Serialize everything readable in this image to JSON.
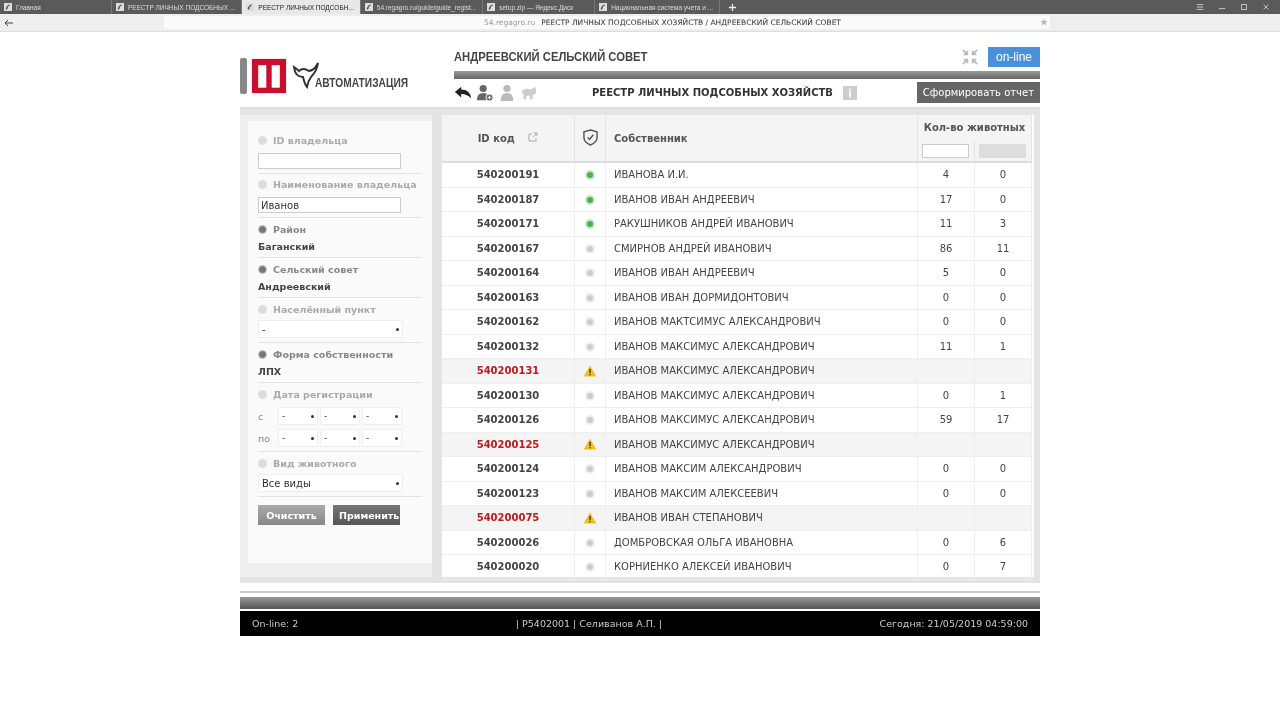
{
  "browser": {
    "tabs": [
      {
        "label": "Главная",
        "selected": false
      },
      {
        "label": "РЕЕСТР ЛИЧНЫХ ПОДСОБНЫХ ...",
        "selected": false
      },
      {
        "label": "РЕЕСТР ЛИЧНЫХ ПОДСОБН...",
        "selected": true
      },
      {
        "label": "54.regagro.ru/guide/guide_regist...",
        "selected": false
      },
      {
        "label": "setup.zip — Яндекс.Диск",
        "selected": false
      },
      {
        "label": "Национальная система учета и ...",
        "selected": false
      }
    ],
    "address": {
      "host": "54.regagro.ru",
      "title": "РЕЕСТР ЛИЧНЫХ ПОДСОБНЫХ ХОЗЯЙСТВ / АНДРЕЕВСКИЙ СЕЛЬСКИЙ СОВЕТ"
    }
  },
  "header": {
    "logo_text": "АВТОМАТИЗАЦИЯ",
    "council": "АНДРЕЕВСКИЙ СЕЛЬСКИЙ СОВЕТ",
    "status": "on-line",
    "page_title": "РЕЕСТР ЛИЧНЫХ ПОДСОБНЫХ ХОЗЯЙСТВ",
    "report_button": "Сформировать отчет"
  },
  "filters": [
    {
      "kind": "text",
      "label": "ID владельца",
      "checked": false
    },
    {
      "kind": "text",
      "label": "Наименование владельца",
      "checked": false,
      "value": "Иванов"
    },
    {
      "kind": "static",
      "label": "Район",
      "checked": true,
      "value": "Баганский"
    },
    {
      "kind": "static",
      "label": "Сельский совет",
      "checked": true,
      "value": "Андреевский"
    },
    {
      "kind": "select",
      "label": "Населённый пункт",
      "checked": false,
      "value": "-"
    },
    {
      "kind": "static",
      "label": "Форма собственности",
      "checked": true,
      "value": "ЛПХ"
    },
    {
      "kind": "dates",
      "label": "Дата регистрации",
      "checked": false,
      "rows": [
        {
          "label": "с",
          "values": [
            "-",
            "-",
            "-"
          ]
        },
        {
          "label": "по",
          "values": [
            "-",
            "-",
            "-"
          ]
        }
      ]
    },
    {
      "kind": "select",
      "label": "Вид животного",
      "checked": false,
      "value": "Все виды"
    }
  ],
  "filter_buttons": [
    "Очистить",
    "Применить"
  ],
  "table": {
    "columns": {
      "id": "ID код",
      "owner": "Собственник",
      "animals": "Кол-во животных"
    },
    "rows": [
      {
        "id": "540200191",
        "kind": "active",
        "owner": "ИВАНОВА И.И.",
        "col_1": "4",
        "col_2": "0"
      },
      {
        "id": "540200187",
        "kind": "active",
        "owner": "ИВАНОВ ИВАН АНДРЕЕВИЧ",
        "col_1": "17",
        "col_2": "0"
      },
      {
        "id": "540200171",
        "kind": "active",
        "owner": "РАКУШНИКОВ АНДРЕЙ ИВАНОВИЧ",
        "col_1": "11",
        "col_2": "3"
      },
      {
        "id": "540200167",
        "kind": "inactive",
        "owner": "СМИРНОВ АНДРЕЙ ИВАНОВИЧ",
        "col_1": "86",
        "col_2": "11"
      },
      {
        "id": "540200164",
        "kind": "inactive",
        "owner": "ИВАНОВ ИВАН АНДРЕЕВИЧ",
        "col_1": "5",
        "col_2": "0"
      },
      {
        "id": "540200163",
        "kind": "inactive",
        "owner": "ИВАНОВ ИВАН ДОРМИДОНТОВИЧ",
        "col_1": "0",
        "col_2": "0"
      },
      {
        "id": "540200162",
        "kind": "inactive",
        "owner": "ИВАНОВ МАКТСИМУС АЛЕКСАНДРОВИЧ",
        "col_1": "0",
        "col_2": "0"
      },
      {
        "id": "540200132",
        "kind": "inactive",
        "owner": "ИВАНОВ МАКСИМУС АЛЕКСАНДРОВИЧ",
        "col_1": "11",
        "col_2": "1"
      },
      {
        "id": "540200131",
        "kind": "warning",
        "owner": "ИВАНОВ МАКСИМУС АЛЕКСАНДРОВИЧ"
      },
      {
        "id": "540200130",
        "kind": "inactive",
        "owner": "ИВАНОВ МАКСИМУС АЛЕКСАНДРОВИЧ",
        "col_1": "0",
        "col_2": "1"
      },
      {
        "id": "540200126",
        "kind": "inactive",
        "owner": "ИВАНОВ МАКСИМУС АЛЕКСАНДРОВИЧ",
        "col_1": "59",
        "col_2": "17"
      },
      {
        "id": "540200125",
        "kind": "warning",
        "owner": "ИВАНОВ МАКСИМУС АЛЕКСАНДРОВИЧ"
      },
      {
        "id": "540200124",
        "kind": "inactive",
        "owner": "ИВАНОВ МАКСИМ АЛЕКСАНДРОВИЧ",
        "col_1": "0",
        "col_2": "0"
      },
      {
        "id": "540200123",
        "kind": "inactive",
        "owner": "ИВАНОВ МАКСИМ АЛЕКСЕЕВИЧ",
        "col_1": "0",
        "col_2": "0"
      },
      {
        "id": "540200075",
        "kind": "warning",
        "owner": "ИВАНОВ ИВАН СТЕПАНОВИЧ"
      },
      {
        "id": "540200026",
        "kind": "inactive",
        "owner": "ДОМБРОВСКАЯ ОЛЬГА ИВАНОВНА",
        "col_1": "0",
        "col_2": "6"
      },
      {
        "id": "540200020",
        "kind": "inactive",
        "owner": "КОРНИЕНКО АЛЕКСЕЙ ИВАНОВИЧ",
        "col_1": "0",
        "col_2": "7"
      }
    ]
  },
  "footer": {
    "online": "On-line: 2",
    "user": "|  Р5402001  |  Селиванов А.П.  |",
    "date": "Сегодня: 21/05/2019 04:59:00"
  }
}
